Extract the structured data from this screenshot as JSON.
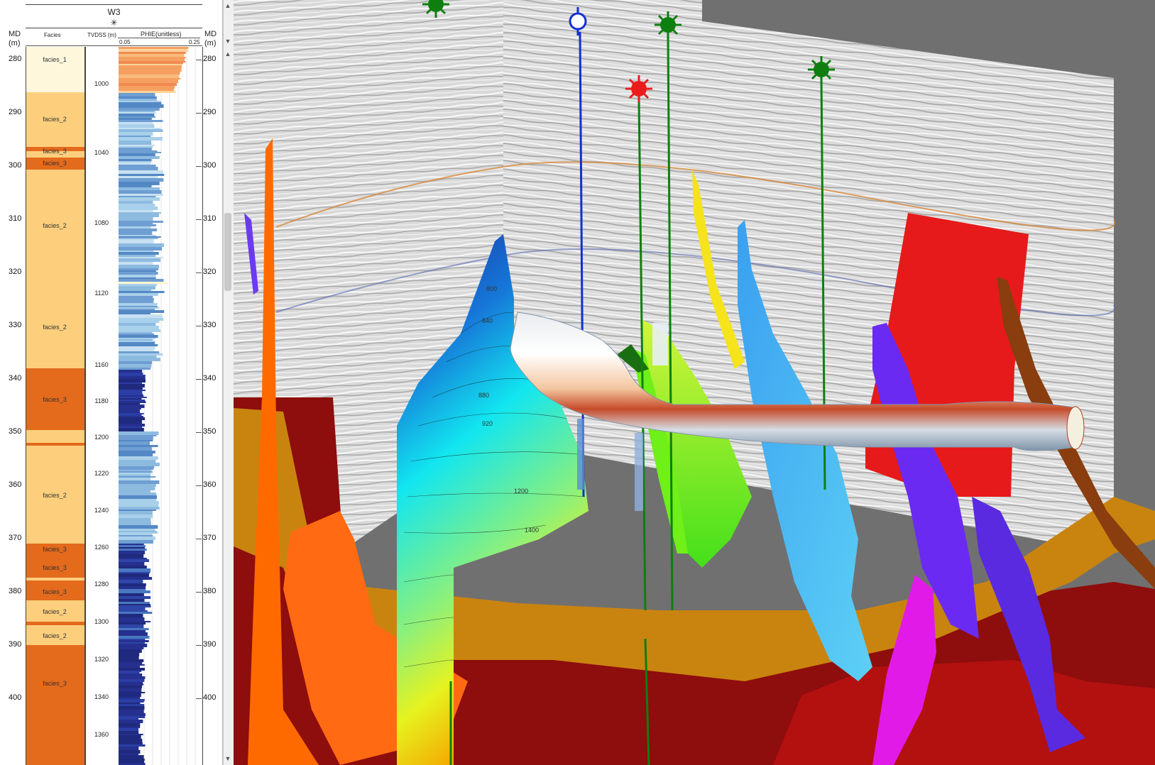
{
  "well_log": {
    "well_name": "W3",
    "well_symbol": "✳",
    "md_label": "MD",
    "md_unit": "(m)",
    "facies_header": "Facies",
    "tvd_header": "TVDSS (m)",
    "phie_header": "PHIE(unitless)",
    "phie_min": "0.05",
    "phie_max": "0.25",
    "md_ticks": [
      "280",
      "290",
      "300",
      "310",
      "320",
      "330",
      "340",
      "350",
      "360",
      "370",
      "380",
      "390",
      "400"
    ],
    "tvd_ticks": [
      "1000",
      "1040",
      "1080",
      "1120",
      "1160",
      "1180",
      "1200",
      "1220",
      "1240",
      "1260",
      "1280",
      "1300",
      "1320",
      "1340",
      "1360"
    ],
    "facies_labels": [
      "facies_1",
      "facies_2",
      "facies_3",
      "facies_3",
      "facies_2",
      "facies_2",
      "facies_3",
      "facies_2",
      "facies_3",
      "facies_3",
      "facies_3",
      "facies_2",
      "facies_2",
      "facies_3"
    ]
  },
  "colors": {
    "facies_1": "#fff7dc",
    "facies_2": "#fdcf7d",
    "facies_3": "#e46a1c",
    "seismic_bg": "#dcdcdc",
    "horizon_gold": "#c98410",
    "horizon_red": "#8e0d0d",
    "well_green": "#0e7f0e",
    "well_blue": "#1430d0",
    "well_red": "#ea1c1c"
  },
  "viewport": {
    "wells": [
      {
        "symbol": "sun-icon",
        "color": "green"
      },
      {
        "symbol": "circle-icon",
        "color": "blue"
      },
      {
        "symbol": "sun-icon",
        "color": "green"
      },
      {
        "symbol": "sun-icon",
        "color": "red"
      },
      {
        "symbol": "sun-icon",
        "color": "green"
      }
    ],
    "contour_labels": [
      "800",
      "840",
      "880",
      "920",
      "1200",
      "1400"
    ]
  }
}
